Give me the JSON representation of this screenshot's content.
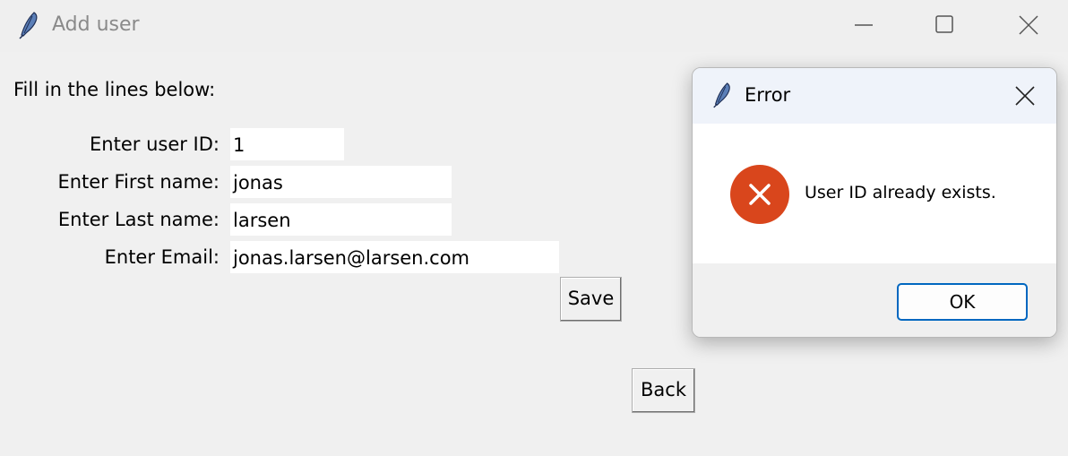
{
  "window": {
    "title": "Add user",
    "icon": "feather-icon"
  },
  "form": {
    "instruction": "Fill in the lines below:",
    "fields": [
      {
        "label": "Enter user ID:",
        "value": "1"
      },
      {
        "label": "Enter First name:",
        "value": "jonas"
      },
      {
        "label": "Enter Last name:",
        "value": "larsen"
      },
      {
        "label": "Enter Email:",
        "value": "jonas.larsen@larsen.com"
      }
    ],
    "save_label": "Save",
    "back_label": "Back"
  },
  "dialog": {
    "title": "Error",
    "icon": "feather-icon",
    "message": "User ID already exists.",
    "ok_label": "OK",
    "status_icon": "error-icon"
  },
  "colors": {
    "error_red": "#d9461c",
    "accent_blue": "#0067c0"
  }
}
